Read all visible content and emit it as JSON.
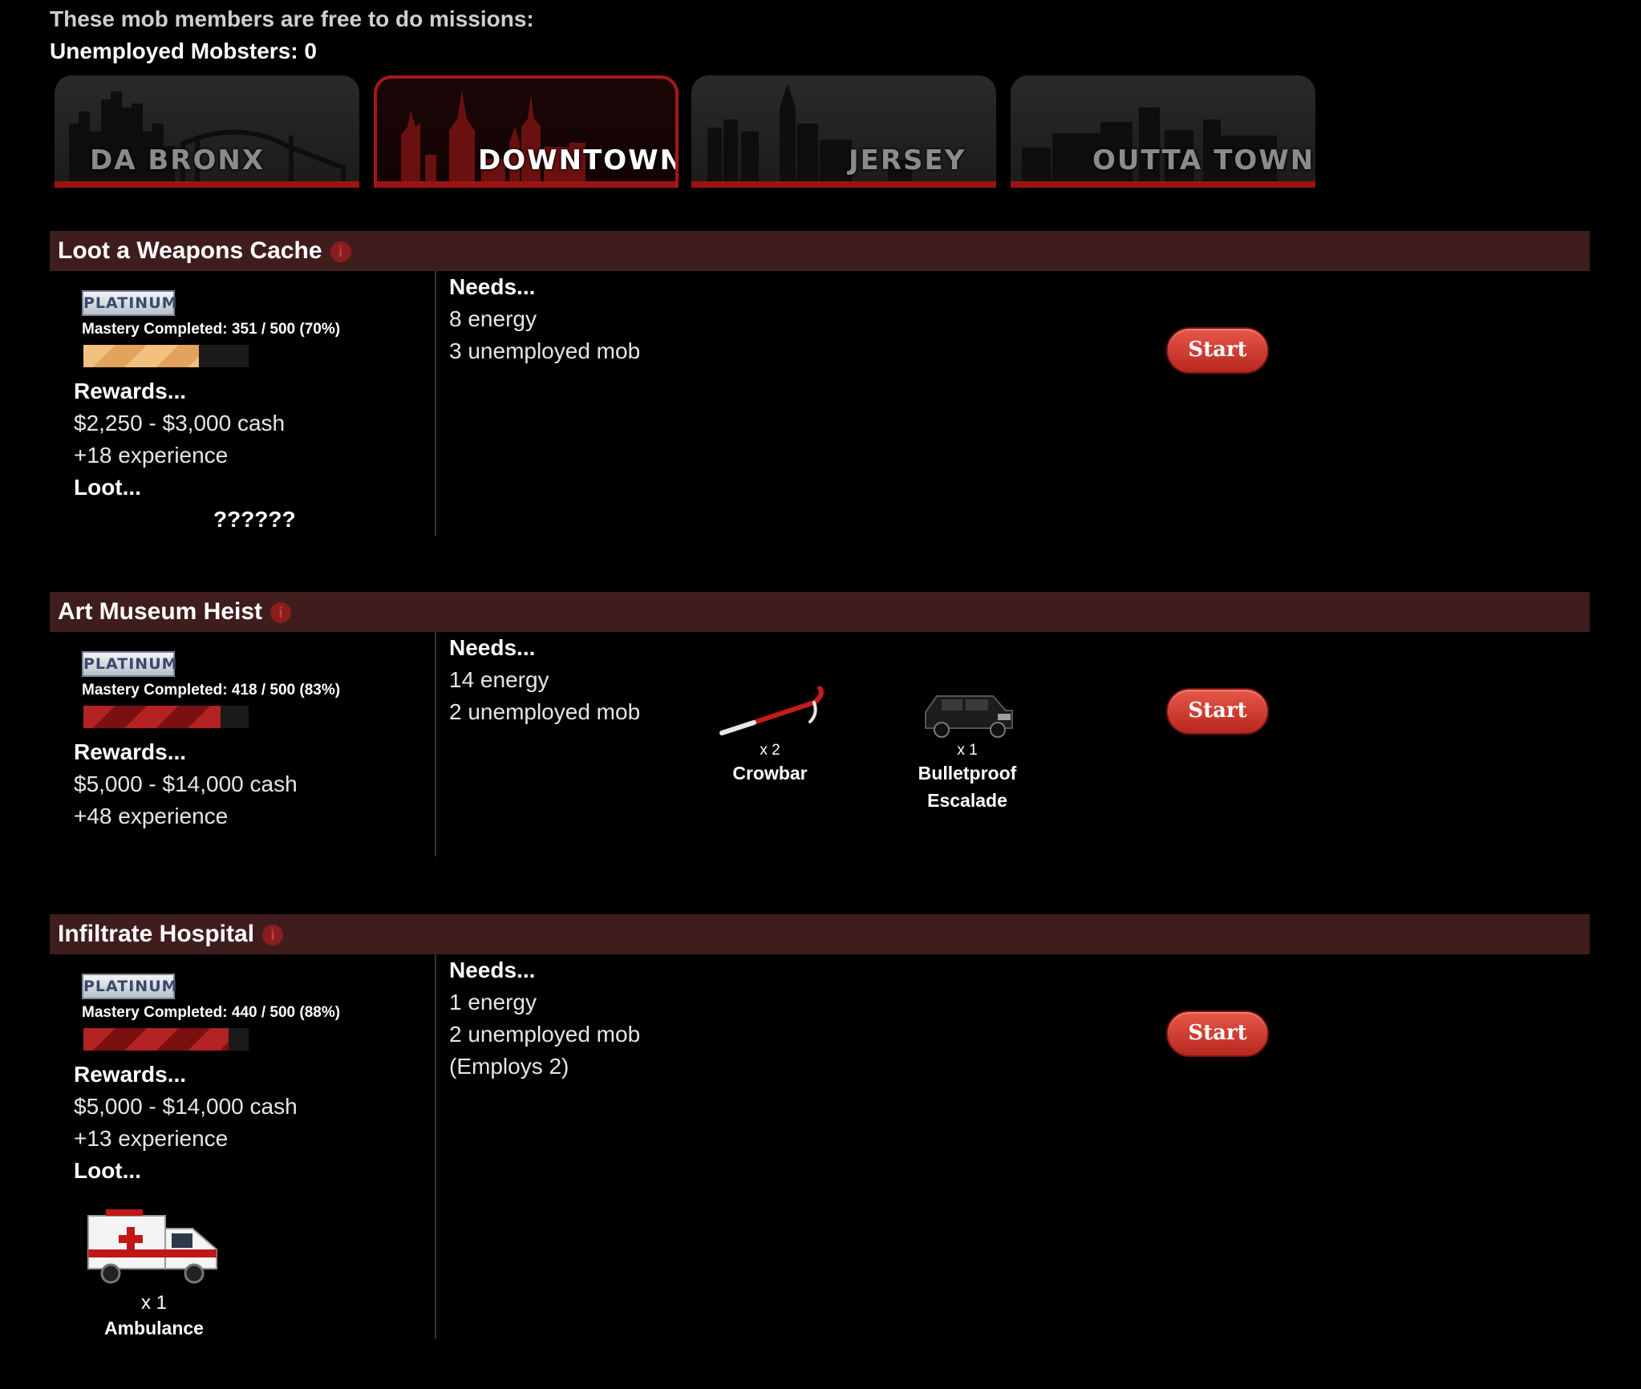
{
  "header": {
    "free_text": "These mob members are free to do missions:",
    "unemployed_label": "Unemployed Mobsters:",
    "unemployed_count": "0"
  },
  "tabs": [
    {
      "label": "DA BRONX",
      "active": false
    },
    {
      "label": "DOWNTOWN",
      "active": true
    },
    {
      "label": "JERSEY",
      "active": false
    },
    {
      "label": "OUTTA TOWN",
      "active": false
    }
  ],
  "missions": [
    {
      "title": "Loot a Weapons Cache",
      "badge": "PLATINUM",
      "mastery": "Mastery Completed: 351 / 500 (70%)",
      "mastery_fraction": 0.7,
      "rewards_label": "Rewards...",
      "rewards": [
        "$2,250 - $3,000 cash",
        "+18 experience"
      ],
      "loot_label": "Loot...",
      "loot_unknown": "??????",
      "needs_label": "Needs...",
      "needs": [
        "8 energy",
        "3 unemployed mob"
      ],
      "start_label": "Start"
    },
    {
      "title": "Art Museum Heist",
      "badge": "PLATINUM",
      "mastery": "Mastery Completed: 418 / 500 (83%)",
      "mastery_fraction": 0.83,
      "rewards_label": "Rewards...",
      "rewards": [
        "$5,000 - $14,000 cash",
        "+48 experience"
      ],
      "needs_label": "Needs...",
      "needs": [
        "14 energy",
        "2 unemployed mob"
      ],
      "items": [
        {
          "qty": "x 2",
          "name": "Crowbar"
        },
        {
          "qty": "x 1",
          "name_line1": "Bulletproof",
          "name_line2": "Escalade"
        }
      ],
      "start_label": "Start"
    },
    {
      "title": "Infiltrate Hospital",
      "badge": "PLATINUM",
      "mastery": "Mastery Completed: 440 / 500 (88%)",
      "mastery_fraction": 0.88,
      "rewards_label": "Rewards...",
      "rewards": [
        "$5,000 - $14,000 cash",
        "+13 experience"
      ],
      "loot_label": "Loot...",
      "loot_item": {
        "qty": "x 1",
        "name": "Ambulance"
      },
      "needs_label": "Needs...",
      "needs": [
        "1 energy",
        "2 unemployed mob",
        "(Employs 2)"
      ],
      "start_label": "Start"
    }
  ],
  "colors": {
    "background": "#000000",
    "mission_bar": "#401d1d",
    "tab_accent": "#9a1414",
    "start_button": "#d43b2e",
    "mastery_gold": "#f3c07f",
    "mastery_red": "#b32323"
  }
}
